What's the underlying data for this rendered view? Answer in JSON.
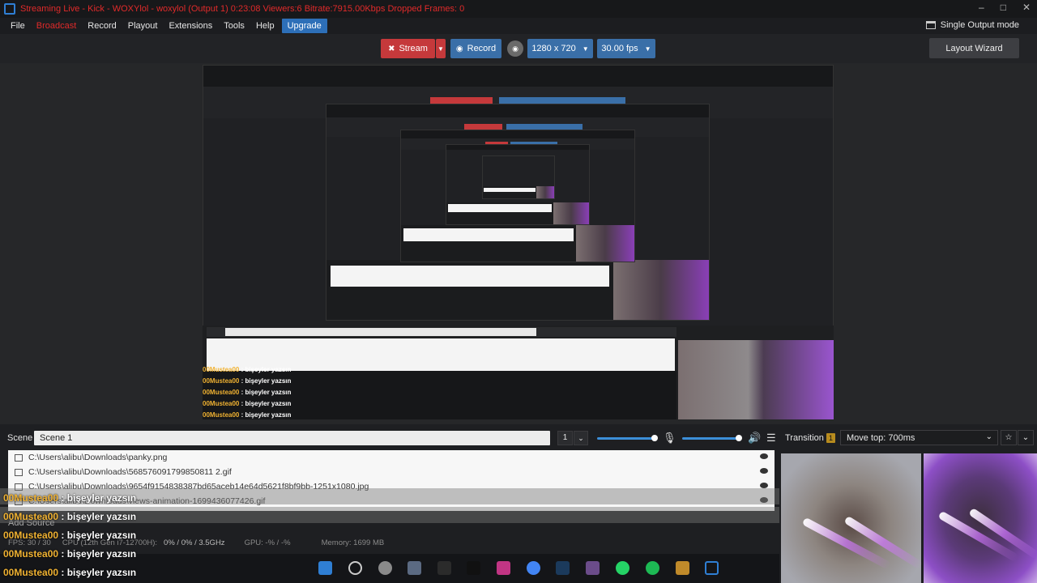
{
  "window": {
    "title": "Streaming Live - Kick - WOXYlol - woxylol (Output 1) 0:23:08  Viewers:6  Bitrate:7915.00Kbps  Dropped Frames: 0"
  },
  "menu": {
    "items": [
      {
        "label": "File"
      },
      {
        "label": "Broadcast"
      },
      {
        "label": "Record"
      },
      {
        "label": "Playout"
      },
      {
        "label": "Extensions"
      },
      {
        "label": "Tools"
      },
      {
        "label": "Help"
      },
      {
        "label": "Upgrade"
      }
    ],
    "output_mode": "Single Output mode"
  },
  "toolbar": {
    "stream_label": "Stream",
    "record_label": "Record",
    "resolution": "1280 x 720",
    "fps": "30.00 fps",
    "layout_wizard": "Layout Wizard"
  },
  "scene": {
    "label": "Scene",
    "name": "Scene 1",
    "number": "1"
  },
  "transition": {
    "label": "Transition",
    "badge": "1",
    "value": "Move top: 700ms"
  },
  "sources": [
    {
      "path": "C:\\Users\\alibu\\Downloads\\panky.png"
    },
    {
      "path": "C:\\Users\\alibu\\Downloads\\568576091799850811 2.gif"
    },
    {
      "path": "C:\\Users\\alibu\\Downloads\\9654f9154838387bd65aceb14e64d5621f8bf9bb-1251x1080.jpg"
    },
    {
      "path": "C:\\Users\\alibu\\Downloads\\views-animation-1699436077426.gif"
    }
  ],
  "add_source": "Add Source",
  "status": {
    "fps": "FPS: 30 / 30",
    "cpu_label": "CPU (12th Gen i7-12700H):",
    "cpu_value": "0% / 0% / 3.5GHz",
    "gpu": "GPU: -% / -%",
    "memory": "Memory: 1699 MB"
  },
  "chat": {
    "messages": [
      {
        "user": "00Mustea00",
        "text": " : bişeyler yazsın"
      },
      {
        "user": "00Mustea00",
        "text": " : bişeyler yazsın"
      },
      {
        "user": "00Mustea00",
        "text": " : bişeyler yazsın"
      },
      {
        "user": "00Mustea00",
        "text": " : bişeyler yazsın"
      },
      {
        "user": "00Mustea00",
        "text": " : bişeyler yazsın"
      }
    ]
  },
  "colors": {
    "stream": "#c5393b",
    "accent": "#3a6fa8",
    "chat_user": "#f0b232",
    "title": "#e02a2a"
  },
  "volume": {
    "mic_level": 0.95,
    "desktop_level": 0.95
  }
}
